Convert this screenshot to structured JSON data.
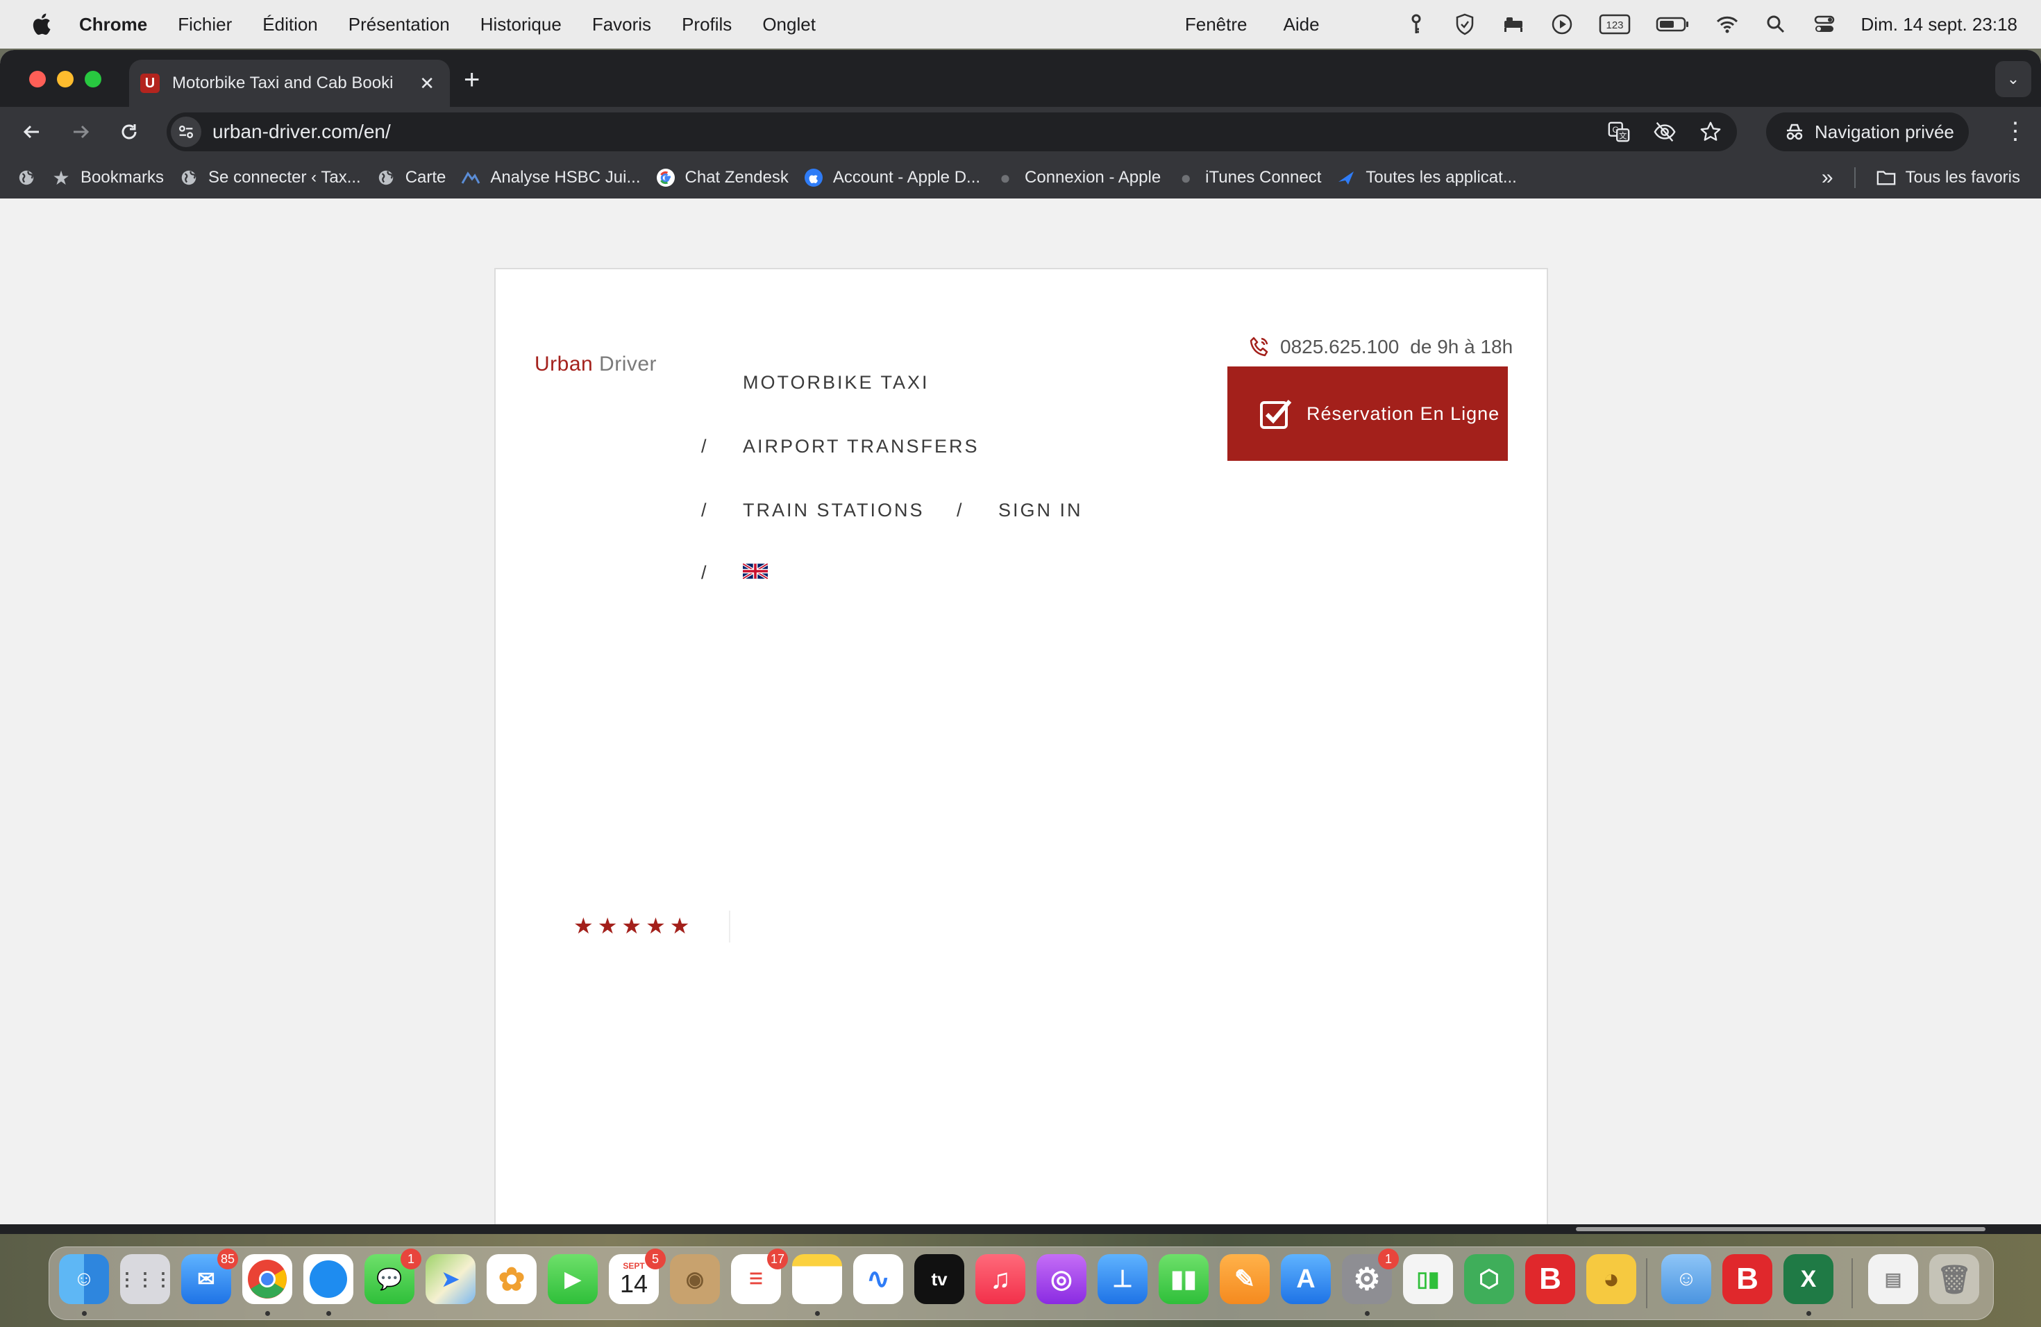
{
  "menubar": {
    "app": "Chrome",
    "items": [
      "Fichier",
      "Édition",
      "Présentation",
      "Historique",
      "Favoris",
      "Profils",
      "Onglet"
    ],
    "right_items": [
      "Fenêtre",
      "Aide"
    ],
    "clock": "Dim. 14 sept.  23:18",
    "status_icons": [
      "key-icon",
      "shield-icon",
      "bed-icon",
      "play-icon",
      "keyboard-123-icon",
      "battery-icon",
      "wifi-icon",
      "search-icon",
      "control-center-icon"
    ]
  },
  "browser": {
    "tab": {
      "favicon": "U",
      "title": "Motorbike Taxi and Cab Booki"
    },
    "url": "urban-driver.com/en/",
    "incognito_label": "Navigation privée",
    "bookmarks": [
      {
        "label": "Bookmarks",
        "icon": "star-icon"
      },
      {
        "label": "Se connecter ‹ Tax...",
        "icon": "globe-icon"
      },
      {
        "label": "Carte",
        "icon": "globe-icon"
      },
      {
        "label": "Analyse HSBC Jui...",
        "icon": "chart-wave-icon"
      },
      {
        "label": "Chat Zendesk",
        "icon": "google-icon"
      },
      {
        "label": "Account - Apple D...",
        "icon": "apple-blue-icon"
      },
      {
        "label": "Connexion - Apple",
        "icon": "apple-icon"
      },
      {
        "label": "iTunes Connect",
        "icon": "apple-icon"
      },
      {
        "label": "Toutes les applicat...",
        "icon": "testflight-icon"
      }
    ],
    "all_bookmarks_label": "Tous les favoris"
  },
  "page": {
    "logo_first": "Urban",
    "logo_second": " Driver",
    "nav": {
      "motorbike_taxi": "MOTORBIKE TAXI",
      "airport_transfers": "AIRPORT TRANSFERS",
      "train_stations": "TRAIN STATIONS",
      "sign_in": "SIGN IN",
      "separator": "/"
    },
    "phone_number": "0825.625.100",
    "phone_hours": "de 9h à 18h",
    "reservation_label": "Réservation En Ligne",
    "rating_stars": 5,
    "brand_color": "#a3201b"
  },
  "dock": {
    "apps": [
      "Finder",
      "Launchpad",
      "Mail",
      "Chrome",
      "Safari",
      "Messages",
      "Maps",
      "Photos",
      "FaceTime",
      "Calendar",
      "Contacts",
      "Reminders",
      "Notes",
      "Freeform",
      "TV",
      "Music",
      "Podcasts",
      "Keynote",
      "Numbers",
      "Pages",
      "App Store",
      "System Settings",
      "Trading",
      "Keychain",
      "B App",
      "Cyberduck",
      "Finder Folder",
      "B App 2",
      "Excel",
      "Archive",
      "Trash"
    ],
    "badges": {
      "mail": "85",
      "messages": "1",
      "calendar": "5",
      "reminders": "17",
      "settings": "1"
    },
    "calendar_month": "SEPT",
    "calendar_day": "14",
    "tv_label": "tv"
  }
}
